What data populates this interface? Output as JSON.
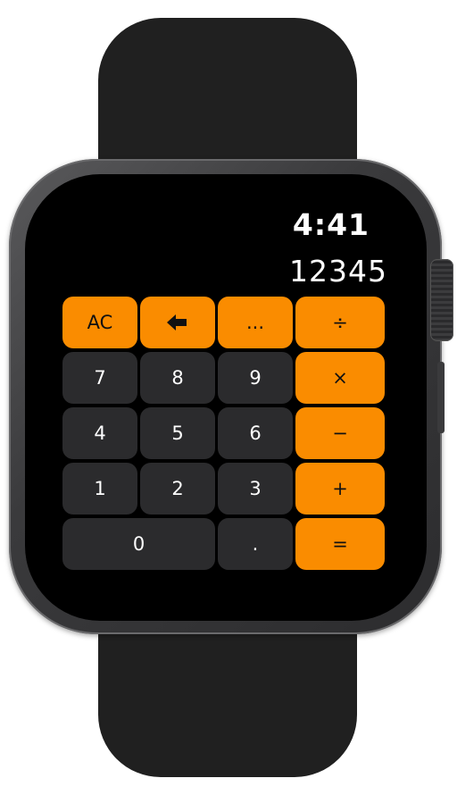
{
  "screen": {
    "time": "4:41",
    "display_value": "12345"
  },
  "keypad": {
    "row1": {
      "clear_label": "AC",
      "backspace_icon": "left-arrow-icon",
      "more_label": "...",
      "divide_label": "÷"
    },
    "row2": {
      "seven": "7",
      "eight": "8",
      "nine": "9",
      "multiply": "×"
    },
    "row3": {
      "four": "4",
      "five": "5",
      "six": "6",
      "minus": "−"
    },
    "row4": {
      "one": "1",
      "two": "2",
      "three": "3",
      "plus": "+"
    },
    "row5": {
      "zero": "0",
      "decimal": ".",
      "equals": "="
    }
  },
  "colors": {
    "operator_key": "#fa8c00",
    "number_key": "#2b2b2d",
    "screen_background": "#000000",
    "band": "#202020"
  }
}
